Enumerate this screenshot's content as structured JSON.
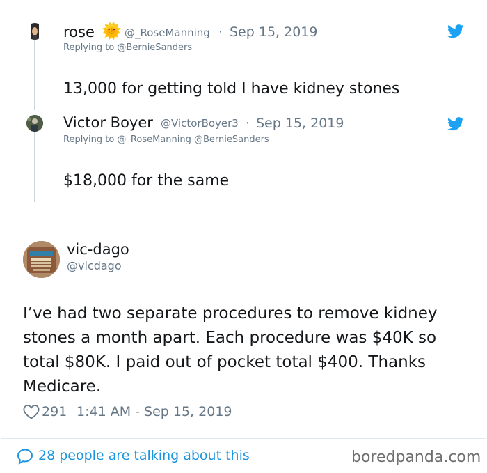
{
  "replies": [
    {
      "name": "rose",
      "emoji": "🌞",
      "handle": "@_RoseManning",
      "separator": "·",
      "date": "Sep 15, 2019",
      "replying": "Replying to @BernieSanders",
      "text": "13,000 for getting told I have kidney stones"
    },
    {
      "name": "Victor Boyer",
      "handle": "@VictorBoyer3",
      "separator": "·",
      "date": "Sep 15, 2019",
      "replying": "Replying to @_RoseManning @BernieSanders",
      "text": "$18,000 for the same"
    }
  ],
  "tweet": {
    "name": "vic-dago",
    "handle": "@vicdago",
    "text_lines": [
      "I’ve had two separate procedures to remove kidney",
      "stones a month apart. Each procedure was $40K so",
      "total $80K. I paid out of pocket total $400. Thanks",
      "Medicare."
    ],
    "likes": "291",
    "time": "1:41 AM - Sep 15, 2019"
  },
  "footer": {
    "conversation": "28 people are talking about this",
    "watermark": "boredpanda.com"
  },
  "colors": {
    "twitter_blue": "#1da1f2",
    "link_blue": "#1b95e0",
    "gray": "#657786",
    "text": "#14171a",
    "watermark": "#6e6e6e"
  },
  "icons": [
    "twitter-bird-icon",
    "heart-icon",
    "speech-bubble-icon"
  ]
}
